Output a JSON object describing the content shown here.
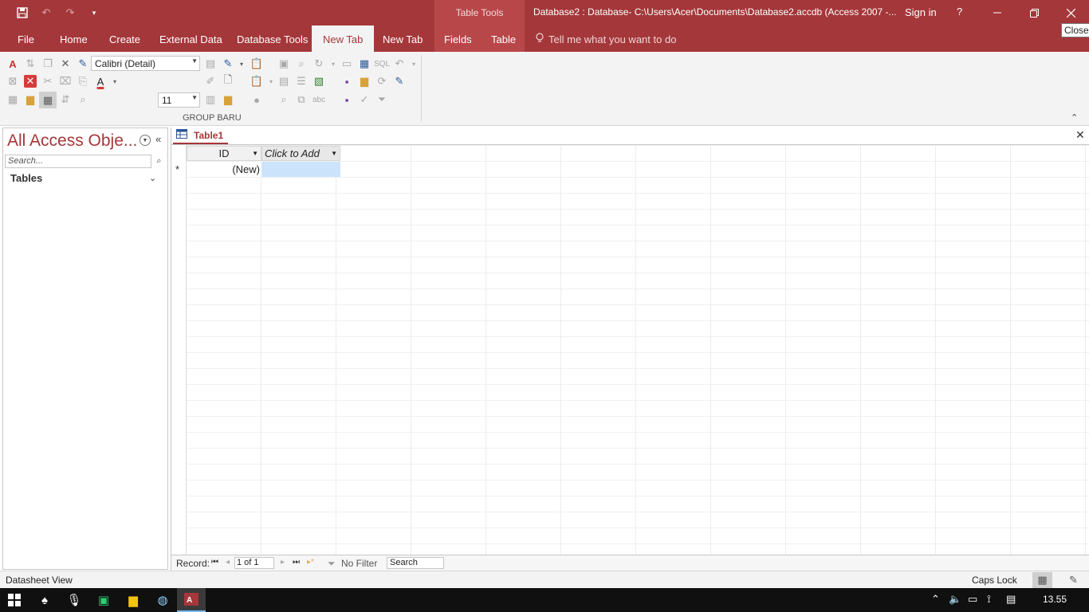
{
  "window": {
    "context_header": "Table Tools",
    "doc_title": "Database2 : Database- C:\\Users\\Acer\\Documents\\Database2.accdb (Access 2007 -...",
    "sign_in": "Sign in",
    "help": "?",
    "close_tooltip": "Close",
    "qat": {
      "save_icon": "save-icon",
      "undo_icon": "undo-icon",
      "redo_icon": "redo-icon",
      "customize_icon": "customize-qat-icon"
    }
  },
  "tabs": [
    "File",
    "Home",
    "Create",
    "External Data",
    "Database Tools",
    "New Tab",
    "New Tab",
    "Fields",
    "Table"
  ],
  "active_tab_index": 5,
  "tell_me": "Tell me what you want to do",
  "ribbon": {
    "font_name": "Calibri (Detail)",
    "font_size": "11",
    "group_label": "GROUP BARU",
    "sql_label": "SQL",
    "spell_label": "abc"
  },
  "nav": {
    "title": "All Access Obje...",
    "search_placeholder": "Search...",
    "group": "Tables"
  },
  "doc": {
    "tab_label": "Table1",
    "columns": [
      "ID",
      "Click to Add"
    ],
    "new_row_marker": "*",
    "new_row_value": "(New)"
  },
  "record_nav": {
    "label": "Record:",
    "current": "1 of 1",
    "filter": "No Filter",
    "search": "Search"
  },
  "status": {
    "text": "Datasheet View",
    "caps": "Caps Lock"
  },
  "taskbar": {
    "time": "13.55"
  },
  "colors": {
    "accent": "#a4373a",
    "selection": "#cce4fb"
  }
}
